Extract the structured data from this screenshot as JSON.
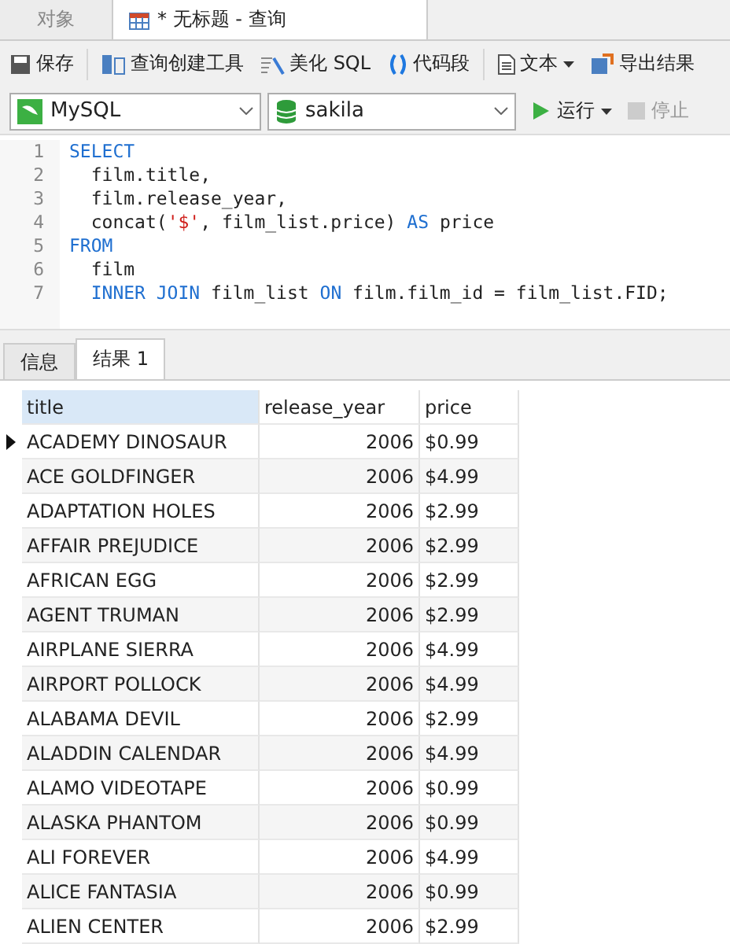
{
  "doc_tabs": [
    {
      "label": "对象",
      "selected": false
    },
    {
      "label": "* 无标题 - 查询",
      "selected": true
    }
  ],
  "toolbar": [
    {
      "label": "保存",
      "kind": "save"
    },
    {
      "label": "查询创建工具",
      "kind": "builder"
    },
    {
      "label": "美化 SQL",
      "kind": "beautify"
    },
    {
      "label": "代码段",
      "kind": "snippet"
    },
    {
      "label": "文本",
      "kind": "text"
    },
    {
      "label": "导出结果",
      "kind": "export"
    }
  ],
  "connection": {
    "value": "MySQL"
  },
  "database": {
    "value": "sakila"
  },
  "run": {
    "label": "运行"
  },
  "stop": {
    "label": "停止",
    "disabled": true
  },
  "editor": {
    "lines": [
      {
        "indent": false,
        "tokens": [
          {
            "kind": "keyword",
            "text": "SELECT"
          }
        ]
      },
      {
        "indent": true,
        "tokens": [
          {
            "kind": "plain",
            "text": "film.title,"
          }
        ]
      },
      {
        "indent": true,
        "tokens": [
          {
            "kind": "plain",
            "text": "film.release_year,"
          }
        ]
      },
      {
        "indent": true,
        "tokens": [
          {
            "kind": "plain",
            "text": "concat("
          },
          {
            "kind": "string",
            "text": "'$'"
          },
          {
            "kind": "plain",
            "text": ", film_list.price) "
          },
          {
            "kind": "keyword",
            "text": "AS"
          },
          {
            "kind": "plain",
            "text": " price"
          }
        ]
      },
      {
        "indent": false,
        "tokens": [
          {
            "kind": "keyword",
            "text": "FROM"
          }
        ]
      },
      {
        "indent": true,
        "tokens": [
          {
            "kind": "plain",
            "text": "film"
          }
        ]
      },
      {
        "indent": true,
        "tokens": [
          {
            "kind": "keyword",
            "text": "INNER JOIN"
          },
          {
            "kind": "plain",
            "text": " film_list "
          },
          {
            "kind": "keyword",
            "text": "ON"
          },
          {
            "kind": "plain",
            "text": " film.film_id = film_list.FID;"
          }
        ]
      }
    ],
    "line_numbers": [
      "1",
      "2",
      "3",
      "4",
      "5",
      "6",
      "7"
    ]
  },
  "result_tabs": [
    {
      "label": "信息",
      "selected": false
    },
    {
      "label": "结果 1",
      "selected": true
    }
  ],
  "table": {
    "columns": [
      "title",
      "release_year",
      "price"
    ],
    "rows": [
      {
        "cells": [
          "ACADEMY DINOSAUR",
          "2006",
          "$0.99"
        ],
        "selected": true
      },
      {
        "cells": [
          "ACE GOLDFINGER",
          "2006",
          "$4.99"
        ],
        "selected": false
      },
      {
        "cells": [
          "ADAPTATION HOLES",
          "2006",
          "$2.99"
        ],
        "selected": false
      },
      {
        "cells": [
          "AFFAIR PREJUDICE",
          "2006",
          "$2.99"
        ],
        "selected": false
      },
      {
        "cells": [
          "AFRICAN EGG",
          "2006",
          "$2.99"
        ],
        "selected": false
      },
      {
        "cells": [
          "AGENT TRUMAN",
          "2006",
          "$2.99"
        ],
        "selected": false
      },
      {
        "cells": [
          "AIRPLANE SIERRA",
          "2006",
          "$4.99"
        ],
        "selected": false
      },
      {
        "cells": [
          "AIRPORT POLLOCK",
          "2006",
          "$4.99"
        ],
        "selected": false
      },
      {
        "cells": [
          "ALABAMA DEVIL",
          "2006",
          "$2.99"
        ],
        "selected": false
      },
      {
        "cells": [
          "ALADDIN CALENDAR",
          "2006",
          "$4.99"
        ],
        "selected": false
      },
      {
        "cells": [
          "ALAMO VIDEOTAPE",
          "2006",
          "$0.99"
        ],
        "selected": false
      },
      {
        "cells": [
          "ALASKA PHANTOM",
          "2006",
          "$0.99"
        ],
        "selected": false
      },
      {
        "cells": [
          "ALI FOREVER",
          "2006",
          "$4.99"
        ],
        "selected": false
      },
      {
        "cells": [
          "ALICE FANTASIA",
          "2006",
          "$0.99"
        ],
        "selected": false
      },
      {
        "cells": [
          "ALIEN CENTER",
          "2006",
          "$2.99"
        ],
        "selected": false
      }
    ]
  }
}
